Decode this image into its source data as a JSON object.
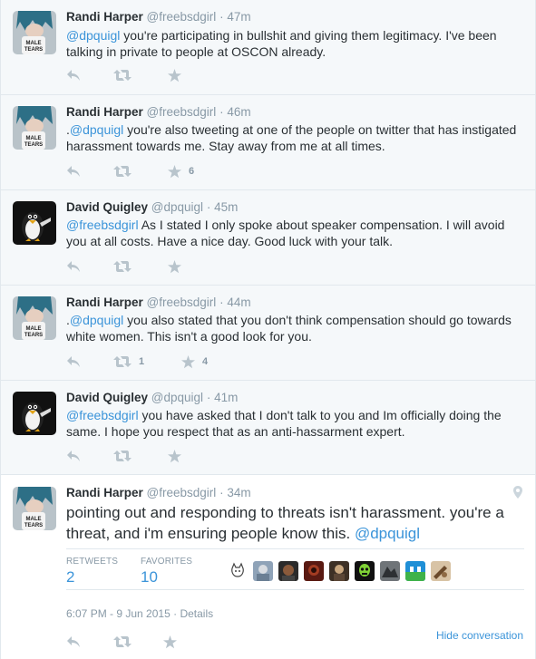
{
  "tweets": [
    {
      "fullname": "Randi Harper",
      "username": "@freebsdgirl",
      "time": "47m",
      "avatar": "randi",
      "mention": "@dpquigl",
      "mention_prefix": "",
      "text": " you're participating in bullshit and giving them legitimacy. I've been talking in private to people at OSCON already.",
      "retweets": "",
      "favorites": ""
    },
    {
      "fullname": "Randi Harper",
      "username": "@freebsdgirl",
      "time": "46m",
      "avatar": "randi",
      "mention_prefix": ".",
      "mention": "@dpquigl",
      "text": " you're also tweeting at one of the people on twitter that has instigated harassment towards me. Stay away from me at all times.",
      "retweets": "",
      "favorites": "6"
    },
    {
      "fullname": "David Quigley",
      "username": "@dpquigl",
      "time": "45m",
      "avatar": "david",
      "mention_prefix": "",
      "mention": "@freebsdgirl",
      "text": " As I stated I only spoke about speaker compensation. I will avoid you at all costs. Have a nice day. Good luck with your talk.",
      "retweets": "",
      "favorites": ""
    },
    {
      "fullname": "Randi Harper",
      "username": "@freebsdgirl",
      "time": "44m",
      "avatar": "randi",
      "mention_prefix": ".",
      "mention": "@dpquigl",
      "text": " you also stated that you don't think compensation should go towards white women. This isn't a good look for you.",
      "retweets": "1",
      "favorites": "4"
    },
    {
      "fullname": "David Quigley",
      "username": "@dpquigl",
      "time": "41m",
      "avatar": "david",
      "mention_prefix": "",
      "mention": "@freebsdgirl",
      "text": " you have asked that I don't talk to you and Im officially doing the same. I hope you respect that as an anti-hassarment expert.",
      "retweets": "",
      "favorites": ""
    }
  ],
  "focused": {
    "fullname": "Randi Harper",
    "username": "@freebsdgirl",
    "time": "34m",
    "text": "pointing out and responding to threats isn't harassment. you're a threat, and i'm ensuring people know this. ",
    "mention": "@dpquigl",
    "retweets_label": "RETWEETS",
    "retweets_value": "2",
    "favorites_label": "FAVORITES",
    "favorites_value": "10",
    "timestamp": "6:07 PM - 9 Jun 2015",
    "details_label": "Details",
    "hide_conversation": "Hide conversation"
  },
  "colors": {
    "link": "#3b94d9",
    "muted": "#8899a6",
    "text": "#292f33",
    "bg_context": "#f5f8fa"
  },
  "icons": [
    "reply-icon",
    "retweet-icon",
    "favorite-icon",
    "location-pin-icon"
  ]
}
